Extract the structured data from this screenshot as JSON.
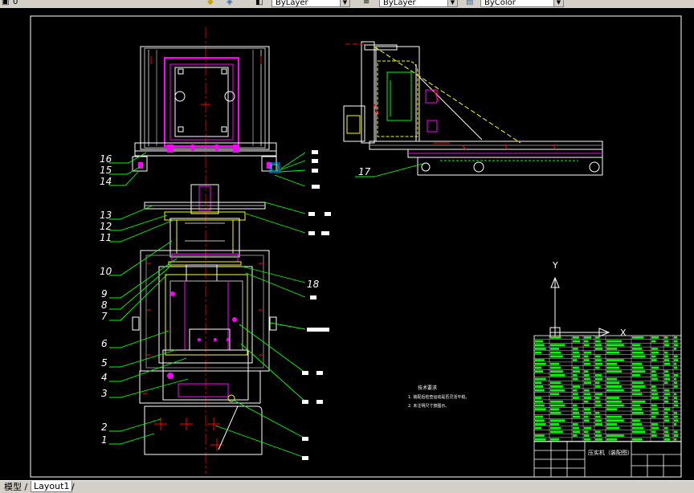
{
  "toolbar": {
    "layer_combo": "ByLayer",
    "linetype_combo": "ByLayer",
    "lineweight_combo": "ByColor"
  },
  "drawing": {
    "part_numbers_left": [
      "16",
      "15",
      "14",
      "13",
      "12",
      "11",
      "10",
      "9",
      "8",
      "7",
      "6",
      "5",
      "4",
      "3",
      "2",
      "1"
    ],
    "part_number_17": "17",
    "part_number_18": "18",
    "notes": {
      "title": "技术要求",
      "lines": [
        "1. 装配后检查运动是否灵活平稳。",
        "2. 未注明尺寸按图示。"
      ]
    },
    "ucs": {
      "y_label": "Y",
      "x_label": "X"
    },
    "title_block": {
      "name": "压实机（装配图）"
    }
  },
  "tabs": [
    {
      "label": "模型 /",
      "active": false
    },
    {
      "label": "Layout1",
      "active": true
    },
    {
      "label": "/",
      "active": false
    }
  ],
  "colors": {
    "background": "#000000",
    "frame": "#ffffff",
    "green": "#00ff00",
    "magenta": "#ff00ff",
    "yellow": "#ffff00",
    "red": "#ff0000",
    "cyan": "#00ffff"
  }
}
